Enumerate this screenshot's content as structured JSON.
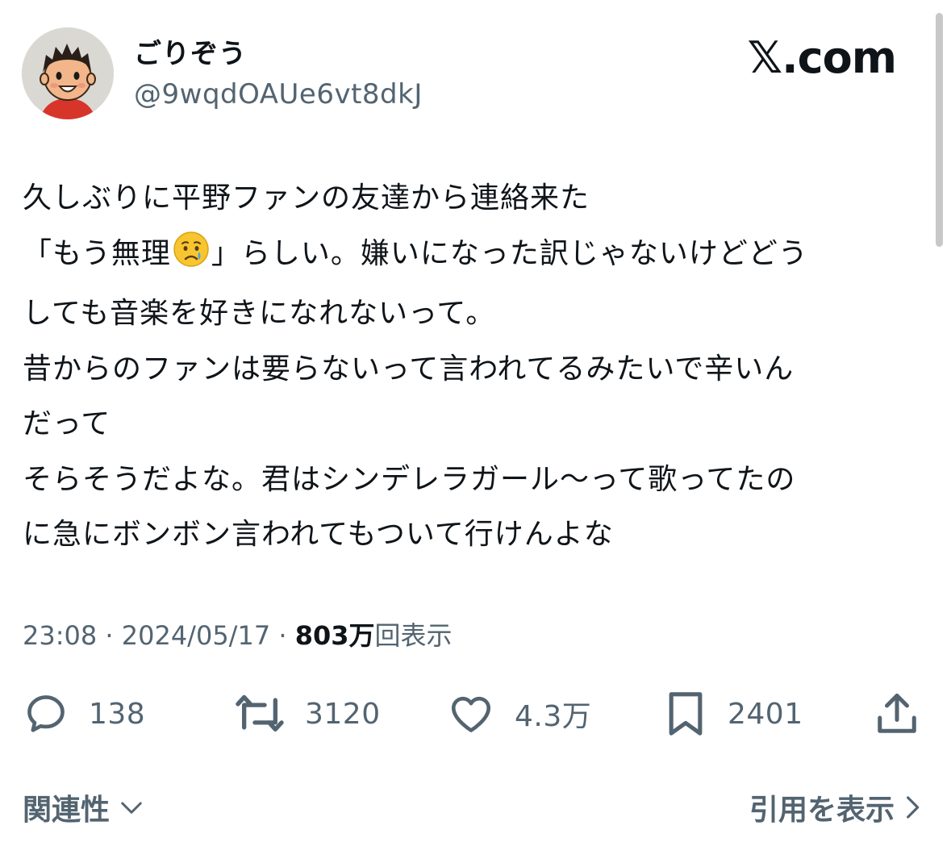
{
  "user": {
    "display_name": "ごりぞう",
    "handle": "@9wqdOAUe6vt8dkJ",
    "avatar_icon": "cartoon-boy-avatar"
  },
  "brand": "𝕏.com",
  "tweet": {
    "line1": "久しぶりに平野ファンの友達から連絡来た",
    "line2_pre": "「もう無理",
    "line2_emoji": "crying-face-emoji",
    "line2_post": "」らしい。嫌いになった訳じゃないけどどう",
    "line3": "しても音楽を好きになれないって。",
    "line4": "昔からのファンは要らないって言われてるみたいで辛いん",
    "line5": "だって",
    "line6": "そらそうだよな。君はシンデレラガール〜って歌ってたの",
    "line7": "に急にボンボン言われてもついて行けんよな"
  },
  "meta": {
    "time": "23:08",
    "sep1": " · ",
    "date": "2024/05/17",
    "sep2": " · ",
    "views": "803万",
    "views_label": "回表示"
  },
  "actions": {
    "replies": "138",
    "retweets": "3120",
    "likes": "4.3万",
    "bookmarks": "2401"
  },
  "footer": {
    "related_label": "関連性",
    "quotes_label": "引用を表示"
  },
  "colors": {
    "text": "#0f1419",
    "muted": "#536471",
    "background": "#ffffff"
  }
}
